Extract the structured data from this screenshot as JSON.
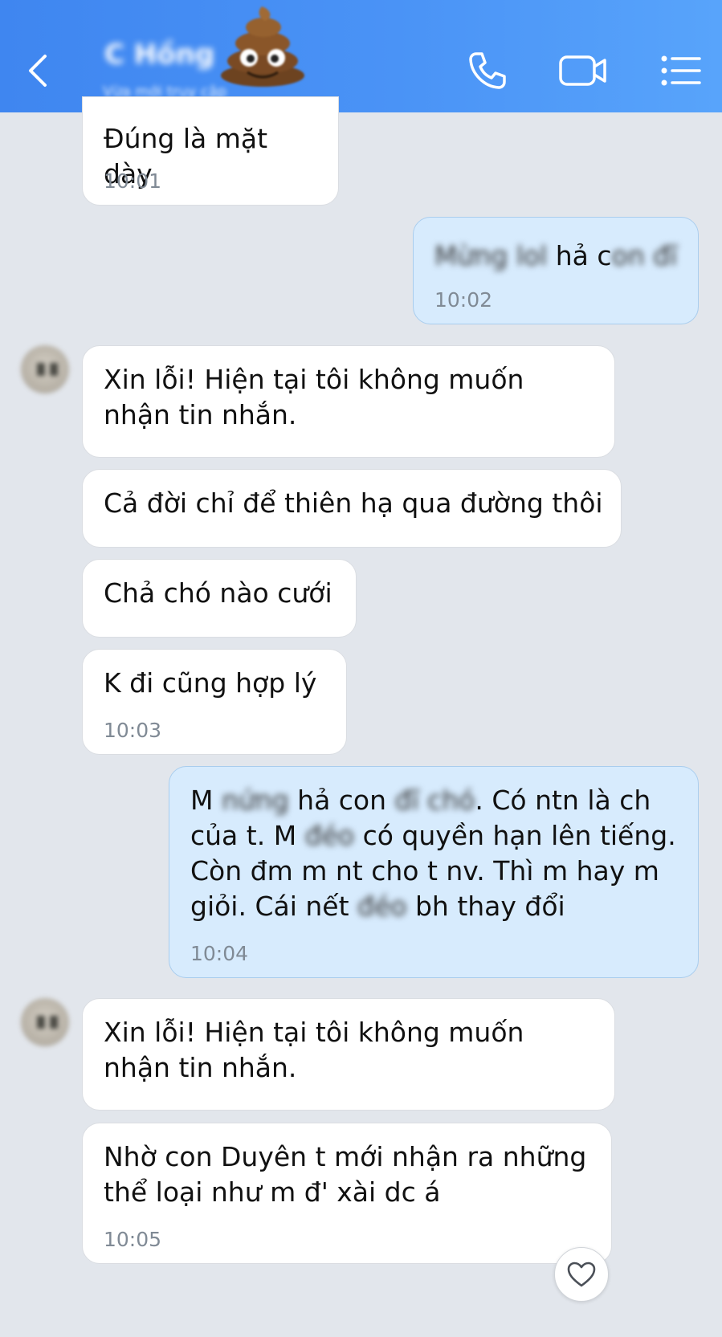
{
  "header": {
    "contact_name": "C Hồng",
    "contact_status": "Vừa mới truy cập",
    "colors": {
      "bar_start": "#3f86f0",
      "bar_end": "#58a4fb",
      "icon": "#ffffff"
    },
    "icons": {
      "back": "chevron-left-icon",
      "call": "phone-icon",
      "video": "video-camera-icon",
      "menu": "list-menu-icon",
      "avatar_sticker": "poo-emoji-icon"
    }
  },
  "messages": [
    {
      "side": "in",
      "text": "Đúng là mặt dày",
      "time": "10:01"
    },
    {
      "side": "out",
      "blur_1": "Mừng lol",
      "text_1": " hả c",
      "blur_2": "on đĩ",
      "time": "10:02"
    },
    {
      "side": "in",
      "text": "Xin lỗi! Hiện tại tôi không muốn nhận tin nhắn."
    },
    {
      "side": "in",
      "text": "Cả đời chỉ để thiên hạ qua đường thôi"
    },
    {
      "side": "in",
      "text": "Chả chó nào cưới"
    },
    {
      "side": "in",
      "text": "K đi cũng hợp lý",
      "time": "10:03"
    },
    {
      "side": "out",
      "p1": "M ",
      "b1": "nứng",
      "p2": " hả con ",
      "b2": "đĩ chó",
      "p3": ". Có ntn là ch của t. M ",
      "b3": "đéo",
      "p4": " có quyền hạn lên tiếng. Còn đm m nt cho t nv. Thì m hay m giỏi. Cái nết ",
      "b4": "đéo",
      "p5": " bh thay đổi",
      "time": "10:04"
    },
    {
      "side": "in",
      "text": "Xin lỗi! Hiện tại tôi không muốn nhận tin nhắn."
    },
    {
      "side": "in",
      "text": "Nhờ con Duyên t mới nhận ra những thể loại như m đ' xài dc á",
      "time": "10:05"
    }
  ],
  "reaction": {
    "icon": "heart-icon"
  },
  "colors": {
    "background": "#e2e6ec",
    "incoming_bubble": "#ffffff",
    "outgoing_bubble": "#d7ebfd",
    "timestamp": "#808a95"
  }
}
